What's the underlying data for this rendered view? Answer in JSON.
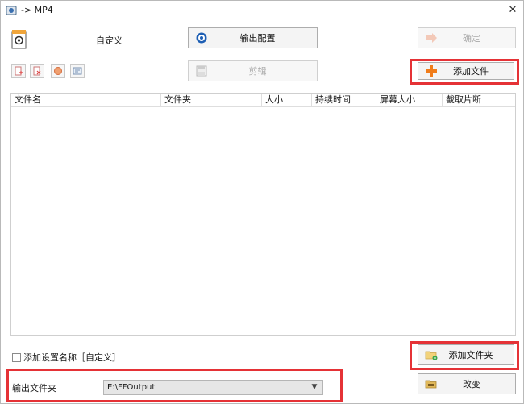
{
  "window": {
    "title": "-> MP4"
  },
  "profile": {
    "label": "自定义"
  },
  "toolbar": {
    "output_config_label": "输出配置",
    "ok_label": "确定",
    "clip_label": "剪辑",
    "add_file_label": "添加文件"
  },
  "table": {
    "columns": [
      "文件名",
      "文件夹",
      "大小",
      "持续时间",
      "屏幕大小",
      "截取片断"
    ]
  },
  "bottom": {
    "add_setting_name_label": "添加设置名称［自定义］",
    "add_folder_label": "添加文件夹",
    "output_folder_label": "输出文件夹",
    "output_folder_value": "E:\\FFOutput",
    "change_label": "改变"
  },
  "colors": {
    "highlight": "#e53236",
    "add_icon": "#f07c1a"
  }
}
